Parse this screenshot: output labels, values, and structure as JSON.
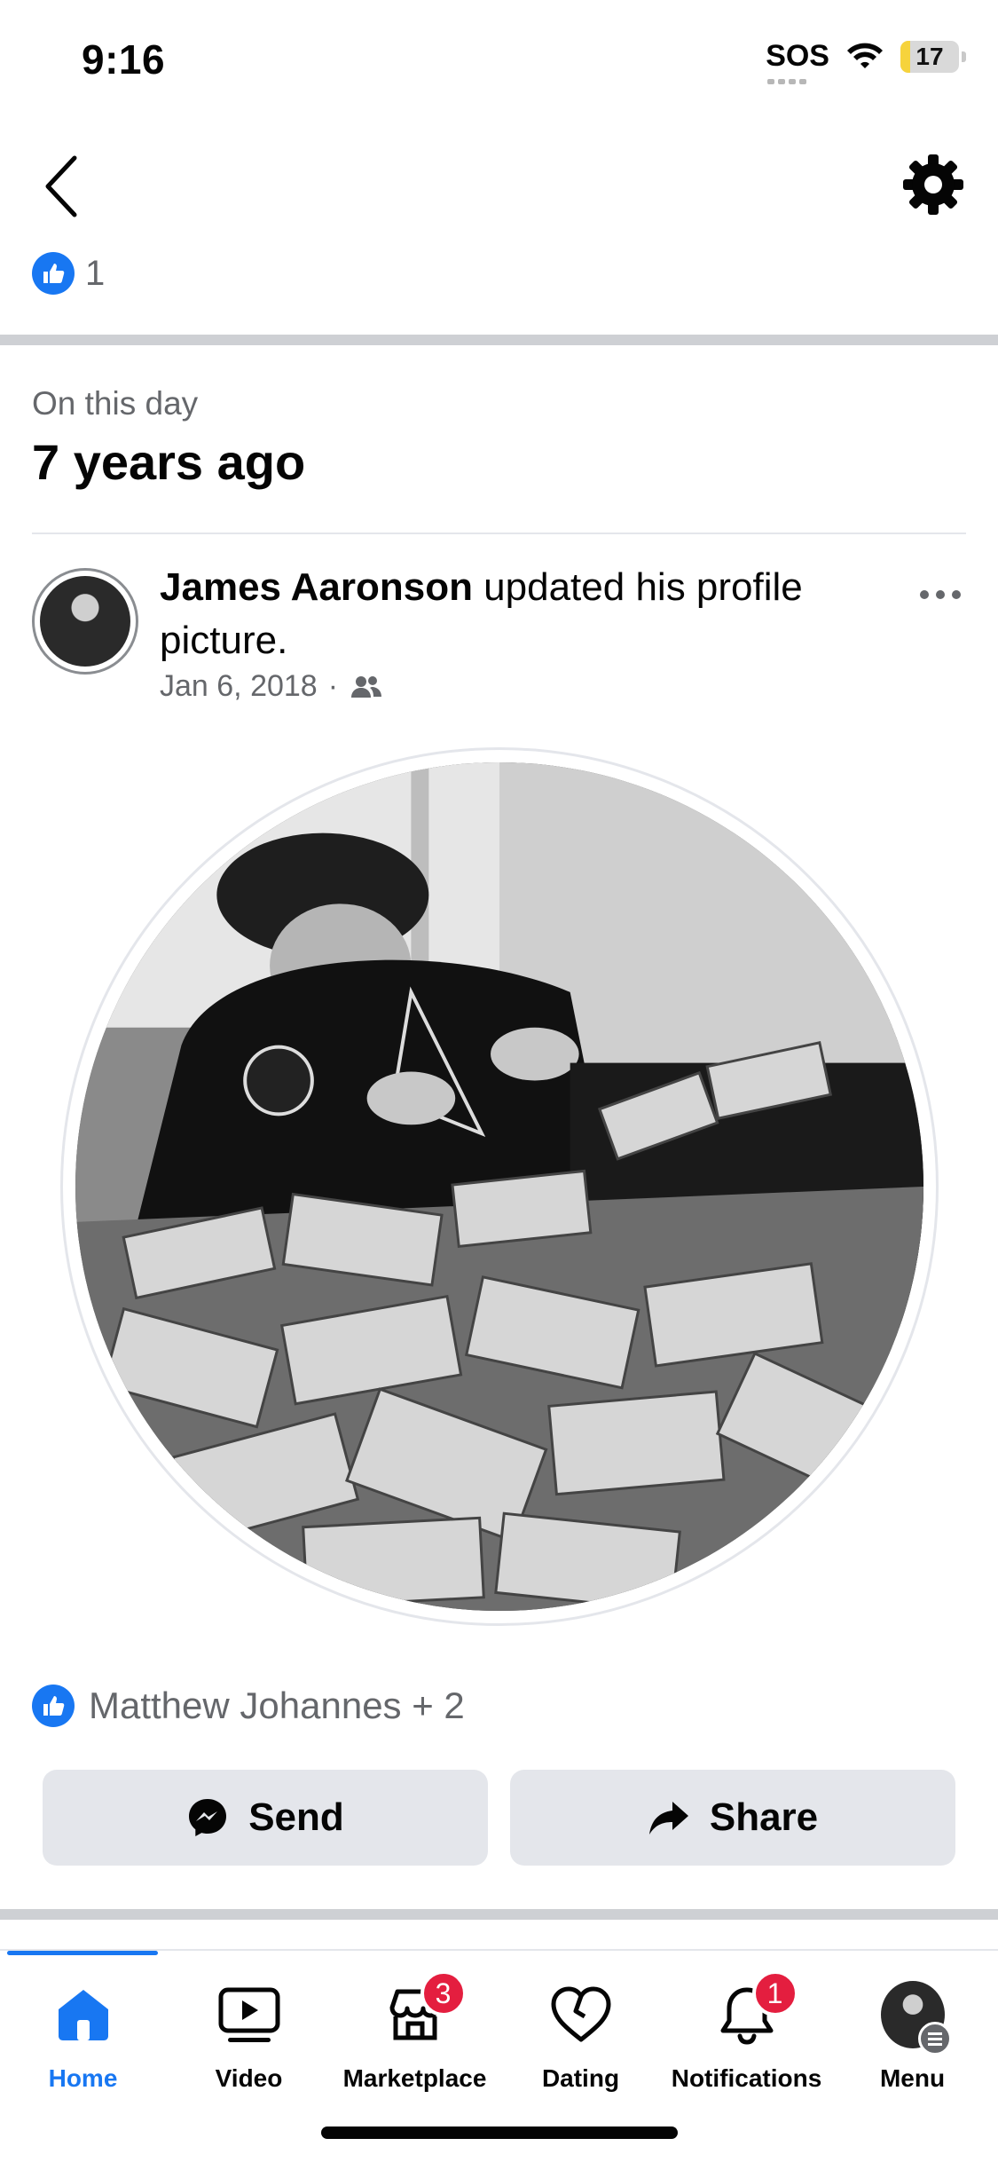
{
  "status_bar": {
    "time": "9:16",
    "signal_label": "SOS",
    "battery_level": "17",
    "battery_fraction": 0.17
  },
  "header": {
    "back_icon": "chevron-left-icon",
    "settings_icon": "gear-icon",
    "like_count": "1"
  },
  "memory": {
    "label": "On this day",
    "title": "7 years ago"
  },
  "post": {
    "author": "James Aaronson",
    "action_text": " updated his profile picture.",
    "date": "Jan 6, 2018",
    "separator": "·",
    "audience_icon": "friends-icon",
    "reactions_text": "Matthew Johannes + 2"
  },
  "actions": {
    "send_label": "Send",
    "share_label": "Share"
  },
  "nav": {
    "items": [
      {
        "label": "Home",
        "icon": "home-icon",
        "active": true
      },
      {
        "label": "Video",
        "icon": "video-icon"
      },
      {
        "label": "Marketplace",
        "icon": "marketplace-icon",
        "badge": "3"
      },
      {
        "label": "Dating",
        "icon": "heart-icon"
      },
      {
        "label": "Notifications",
        "icon": "bell-icon",
        "badge": "1"
      },
      {
        "label": "Menu",
        "icon": "avatar"
      }
    ]
  },
  "colors": {
    "brand_blue": "#1877f2",
    "badge_red": "#e41e3f",
    "secondary_text": "#65676b",
    "button_bg": "#e4e6eb"
  }
}
